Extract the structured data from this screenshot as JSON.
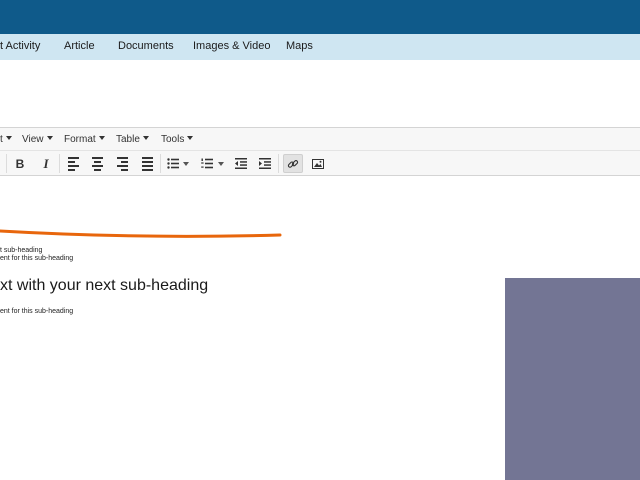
{
  "nav": {
    "tabs": [
      "t Activity",
      "Article",
      "Documents",
      "Images & Video",
      "Maps"
    ]
  },
  "editor_menu": {
    "items": [
      "t",
      "View",
      "Format",
      "Table",
      "Tools"
    ]
  },
  "toolbar": {
    "bold_label": "B",
    "italic_label": "I"
  },
  "content": {
    "line1": "t sub-heading",
    "line2": "ent for this sub-heading",
    "heading": "xt with your next sub-heading",
    "line3": "ent for this sub-heading"
  },
  "colors": {
    "top_bar": "#0f5a8a",
    "nav_bg": "#cfe6f2",
    "annotation_line": "#e8660c",
    "image_placeholder": "#737594"
  }
}
